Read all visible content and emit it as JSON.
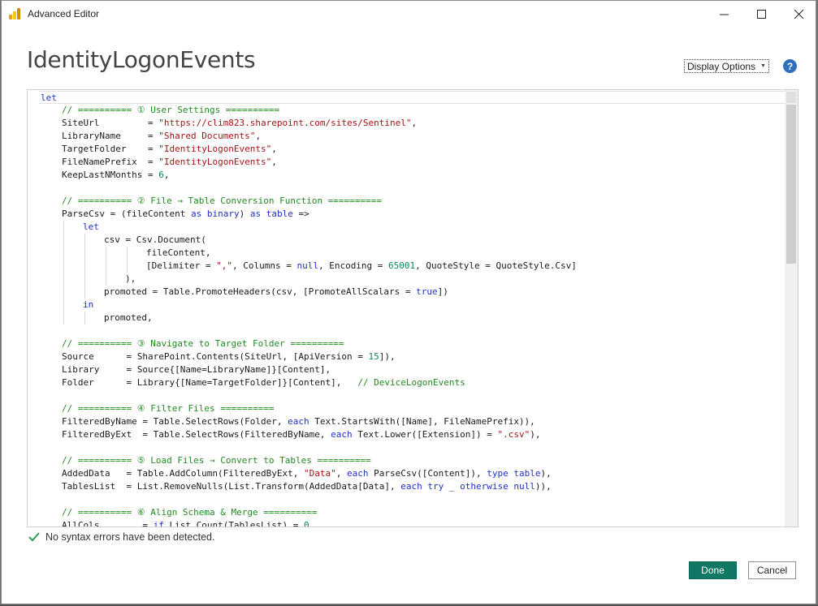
{
  "window": {
    "title": "Advanced Editor",
    "minimize_label": "—",
    "maximize_label": "☐",
    "close_label": "✕"
  },
  "dialog": {
    "query_name": "IdentityLogonEvents",
    "display_options_label": "Display Options",
    "help_label": "?"
  },
  "code_lines": [
    {
      "indent": 0,
      "tokens": [
        {
          "t": "let",
          "c": "kw"
        }
      ]
    },
    {
      "indent": 1,
      "tokens": [
        {
          "t": "// ========== ① User Settings ==========",
          "c": "cmt"
        }
      ]
    },
    {
      "indent": 1,
      "tokens": [
        {
          "t": "SiteUrl         = "
        },
        {
          "t": "\"https://clim823.sharepoint.com/sites/Sentinel\"",
          "c": "str"
        },
        {
          "t": ","
        }
      ]
    },
    {
      "indent": 1,
      "tokens": [
        {
          "t": "LibraryName     = "
        },
        {
          "t": "\"Shared Documents\"",
          "c": "str"
        },
        {
          "t": ","
        }
      ]
    },
    {
      "indent": 1,
      "tokens": [
        {
          "t": "TargetFolder    = "
        },
        {
          "t": "\"IdentityLogonEvents\"",
          "c": "str"
        },
        {
          "t": ","
        }
      ]
    },
    {
      "indent": 1,
      "tokens": [
        {
          "t": "FileNamePrefix  = "
        },
        {
          "t": "\"IdentityLogonEvents\"",
          "c": "str"
        },
        {
          "t": ","
        }
      ]
    },
    {
      "indent": 1,
      "tokens": [
        {
          "t": "KeepLastNMonths = "
        },
        {
          "t": "6",
          "c": "num"
        },
        {
          "t": ","
        }
      ]
    },
    {
      "indent": 0,
      "tokens": []
    },
    {
      "indent": 1,
      "tokens": [
        {
          "t": "// ========== ② File → Table Conversion Function ==========",
          "c": "cmt"
        }
      ]
    },
    {
      "indent": 1,
      "tokens": [
        {
          "t": "ParseCsv = (fileContent "
        },
        {
          "t": "as",
          "c": "kw"
        },
        {
          "t": " "
        },
        {
          "t": "binary",
          "c": "kw"
        },
        {
          "t": ") "
        },
        {
          "t": "as",
          "c": "kw"
        },
        {
          "t": " "
        },
        {
          "t": "table",
          "c": "kw"
        },
        {
          "t": " =>"
        }
      ]
    },
    {
      "indent": 2,
      "tokens": [
        {
          "t": "let",
          "c": "kw"
        }
      ]
    },
    {
      "indent": 3,
      "tokens": [
        {
          "t": "csv = Csv.Document("
        }
      ]
    },
    {
      "indent": 5,
      "tokens": [
        {
          "t": "fileContent,"
        }
      ]
    },
    {
      "indent": 5,
      "tokens": [
        {
          "t": "[Delimiter = "
        },
        {
          "t": "\",\"",
          "c": "str"
        },
        {
          "t": ", Columns = "
        },
        {
          "t": "null",
          "c": "kw"
        },
        {
          "t": ", Encoding = "
        },
        {
          "t": "65001",
          "c": "num"
        },
        {
          "t": ", QuoteStyle = QuoteStyle.Csv]"
        }
      ]
    },
    {
      "indent": 4,
      "tokens": [
        {
          "t": "),"
        }
      ]
    },
    {
      "indent": 3,
      "tokens": [
        {
          "t": "promoted = Table.PromoteHeaders(csv, [PromoteAllScalars = "
        },
        {
          "t": "true",
          "c": "kw"
        },
        {
          "t": "])"
        }
      ]
    },
    {
      "indent": 2,
      "tokens": [
        {
          "t": "in",
          "c": "kw"
        }
      ]
    },
    {
      "indent": 3,
      "tokens": [
        {
          "t": "promoted,"
        }
      ]
    },
    {
      "indent": 0,
      "tokens": []
    },
    {
      "indent": 1,
      "tokens": [
        {
          "t": "// ========== ③ Navigate to Target Folder ==========",
          "c": "cmt"
        }
      ]
    },
    {
      "indent": 1,
      "tokens": [
        {
          "t": "Source      = SharePoint.Contents(SiteUrl, [ApiVersion = "
        },
        {
          "t": "15",
          "c": "num"
        },
        {
          "t": "]),"
        }
      ]
    },
    {
      "indent": 1,
      "tokens": [
        {
          "t": "Library     = Source{[Name=LibraryName]}[Content],"
        }
      ]
    },
    {
      "indent": 1,
      "tokens": [
        {
          "t": "Folder      = Library{[Name=TargetFolder]}[Content],   "
        },
        {
          "t": "// DeviceLogonEvents",
          "c": "cmt"
        }
      ]
    },
    {
      "indent": 0,
      "tokens": []
    },
    {
      "indent": 1,
      "tokens": [
        {
          "t": "// ========== ④ Filter Files ==========",
          "c": "cmt"
        }
      ]
    },
    {
      "indent": 1,
      "tokens": [
        {
          "t": "FilteredByName = Table.SelectRows(Folder, "
        },
        {
          "t": "each",
          "c": "kw"
        },
        {
          "t": " Text.StartsWith([Name], FileNamePrefix)),"
        }
      ]
    },
    {
      "indent": 1,
      "tokens": [
        {
          "t": "FilteredByExt  = Table.SelectRows(FilteredByName, "
        },
        {
          "t": "each",
          "c": "kw"
        },
        {
          "t": " Text.Lower([Extension]) = "
        },
        {
          "t": "\".csv\"",
          "c": "str"
        },
        {
          "t": "),"
        }
      ]
    },
    {
      "indent": 0,
      "tokens": []
    },
    {
      "indent": 1,
      "tokens": [
        {
          "t": "// ========== ⑤ Load Files → Convert to Tables ==========",
          "c": "cmt"
        }
      ]
    },
    {
      "indent": 1,
      "tokens": [
        {
          "t": "AddedData   = Table.AddColumn(FilteredByExt, "
        },
        {
          "t": "\"Data\"",
          "c": "str"
        },
        {
          "t": ", "
        },
        {
          "t": "each",
          "c": "kw"
        },
        {
          "t": " ParseCsv([Content]), "
        },
        {
          "t": "type",
          "c": "kw"
        },
        {
          "t": " "
        },
        {
          "t": "table",
          "c": "kw"
        },
        {
          "t": "),"
        }
      ]
    },
    {
      "indent": 1,
      "tokens": [
        {
          "t": "TablesList  = List.RemoveNulls(List.Transform(AddedData[Data], "
        },
        {
          "t": "each",
          "c": "kw"
        },
        {
          "t": " "
        },
        {
          "t": "try",
          "c": "kw"
        },
        {
          "t": " _ "
        },
        {
          "t": "otherwise",
          "c": "kw"
        },
        {
          "t": " "
        },
        {
          "t": "null",
          "c": "kw"
        },
        {
          "t": ")),"
        }
      ]
    },
    {
      "indent": 0,
      "tokens": []
    },
    {
      "indent": 1,
      "tokens": [
        {
          "t": "// ========== ⑥ Align Schema & Merge ==========",
          "c": "cmt"
        }
      ]
    },
    {
      "indent": 1,
      "tokens": [
        {
          "t": "AllCols        = "
        },
        {
          "t": "if",
          "c": "kw"
        },
        {
          "t": " List.Count(TablesList) = "
        },
        {
          "t": "0",
          "c": "num"
        }
      ]
    }
  ],
  "status": {
    "message": "No syntax errors have been detected."
  },
  "buttons": {
    "done_label": "Done",
    "cancel_label": "Cancel"
  },
  "colors": {
    "keyword": "#1e32c8",
    "string": "#a31515",
    "number": "#098658",
    "comment": "#218a21",
    "done_button": "#117865",
    "success_check": "#2e9b5a"
  }
}
